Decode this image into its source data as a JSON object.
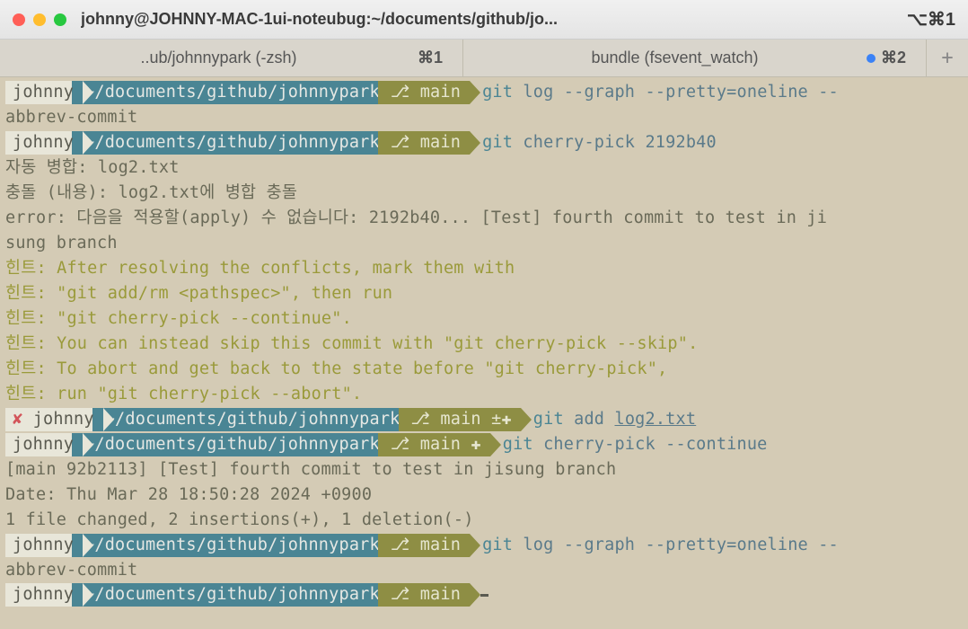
{
  "window": {
    "title": "johnny@JOHNNY-MAC-1ui-noteubug:~/documents/github/jo...",
    "shortcut": "⌥⌘1"
  },
  "tabs": [
    {
      "label": "..ub/johnnypark (-zsh)",
      "shortcut": "⌘1"
    },
    {
      "label": "bundle (fsevent_watch)",
      "shortcut": "⌘2"
    }
  ],
  "prompt": {
    "user": "johnny",
    "user_err": "✘ johnny",
    "path": "~/documents/github/johnnypark",
    "branch": "⎇ main",
    "branch_dirty": "⎇ main ±✚",
    "branch_staged": "⎇ main ✚"
  },
  "cmds": {
    "git": "git",
    "log": " log --graph --pretty=oneline --",
    "abbrev": "abbrev-commit",
    "cherry_pick": " cherry-pick 2192b40",
    "add": " add ",
    "add_file": "log2.txt",
    "cp_continue": " cherry-pick --continue",
    "log2": " log --graph --pretty=oneline --"
  },
  "output": {
    "merge1": "자동 병합: log2.txt",
    "merge2": "충돌 (내용): log2.txt에 병합 충돌",
    "err1": "error: 다음을 적용할(apply) 수 없습니다: 2192b40... [Test] fourth commit to test in ji",
    "err2": "sung branch",
    "hint_label": "힌트:",
    "h1": " After resolving the conflicts, mark them with",
    "h2": " \"git add/rm <pathspec>\", then run",
    "h3": " \"git cherry-pick --continue\".",
    "h4": " You can instead skip this commit with \"git cherry-pick --skip\".",
    "h5": " To abort and get back to the state before \"git cherry-pick\",",
    "h6": " run \"git cherry-pick --abort\".",
    "commit1": "[main 92b2113] [Test] fourth commit to test in jisung branch",
    "commit2": " Date: Thu Mar 28 18:50:28 2024 +0900",
    "commit3": " 1 file changed, 2 insertions(+), 1 deletion(-)"
  }
}
